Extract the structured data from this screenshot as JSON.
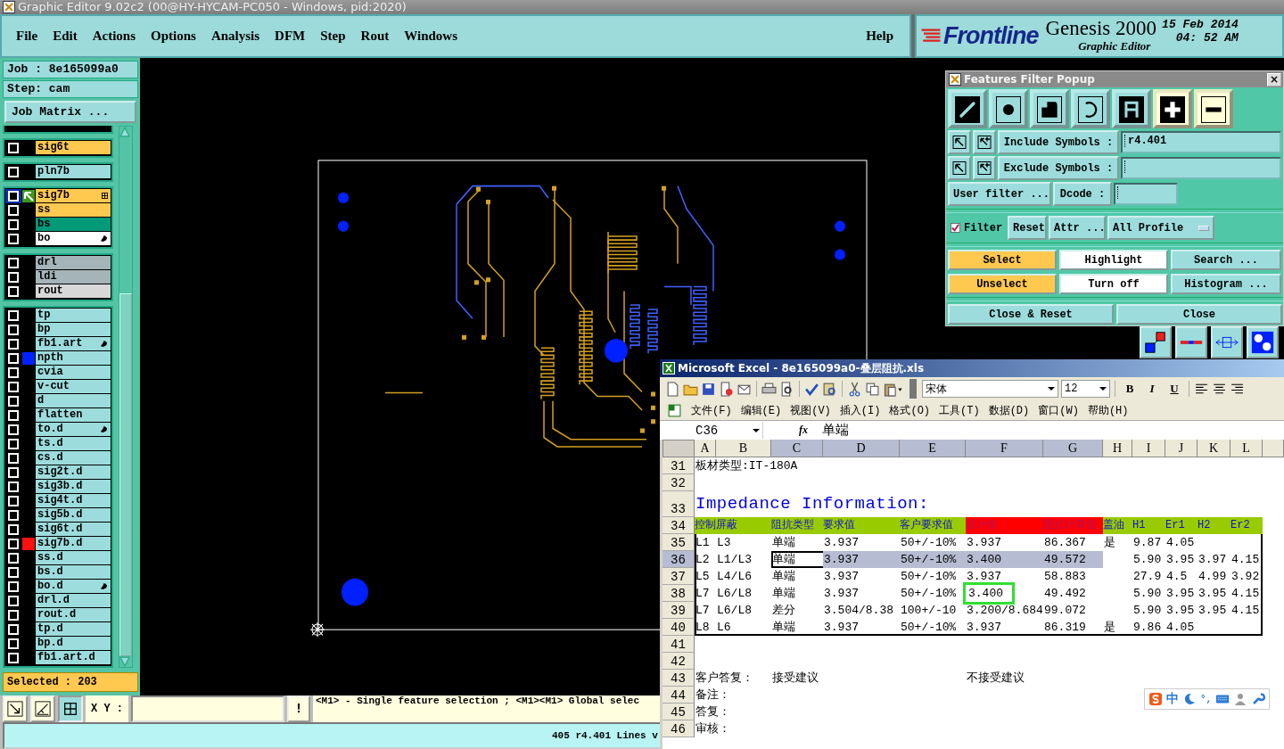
{
  "title_bar": {
    "title": "Graphic Editor 9.02c2 (00@HY-HYCAM-PC050 - Windows, pid:2020)"
  },
  "menu": [
    "File",
    "Edit",
    "Actions",
    "Options",
    "Analysis",
    "DFM",
    "Step",
    "Rout",
    "Windows"
  ],
  "help": "Help",
  "logo": {
    "brand": "Frontline",
    "product": "Genesis 2000",
    "subtitle": "Graphic Editor",
    "date": "15 Feb 2014",
    "time": "04: 52 AM"
  },
  "job": {
    "job": "Job : 8e165099a0",
    "step": "Step: cam",
    "matrix_button": "Job Matrix ...",
    "selected": "Selected : 203"
  },
  "layer_groups": [
    [
      {
        "name": "sig6t",
        "color": "#ffc84f",
        "work": false,
        "hand": false
      }
    ],
    [
      {
        "name": "pln7b",
        "color": "#9ddcdc",
        "work": false,
        "hand": false
      }
    ],
    [
      {
        "name": "sig7b",
        "color": "#ffc84f",
        "work": true,
        "hand": false
      },
      {
        "name": "ss",
        "color": "#ffc84f",
        "work": false,
        "hand": false
      },
      {
        "name": "bs",
        "color": "#009a78",
        "work": false,
        "hand": false
      },
      {
        "name": "bo",
        "color": "#ffffff",
        "work": false,
        "hand": true
      }
    ],
    [
      {
        "name": "drl",
        "color": "#a4b4b8",
        "work": false,
        "hand": false
      },
      {
        "name": "ldi",
        "color": "#a4b4b8",
        "work": false,
        "hand": false
      },
      {
        "name": "rout",
        "color": "#d8d8d8",
        "work": false,
        "hand": false
      }
    ],
    [
      {
        "name": "tp",
        "color": "#9ddcdc",
        "work": false,
        "hand": false
      },
      {
        "name": "bp",
        "color": "#9ddcdc",
        "work": false,
        "hand": false
      },
      {
        "name": "fb1.art",
        "color": "#9ddcdc",
        "work": false,
        "hand": true
      },
      {
        "name": "npth",
        "color": "#9ddcdc",
        "work": false,
        "hand": false,
        "display": {
          "color": "#0022ff"
        }
      },
      {
        "name": "cvia",
        "color": "#9ddcdc",
        "work": false,
        "hand": false
      },
      {
        "name": "v-cut",
        "color": "#9ddcdc",
        "work": false,
        "hand": false
      },
      {
        "name": "d",
        "color": "#9ddcdc",
        "work": false,
        "hand": false
      },
      {
        "name": "flatten",
        "color": "#9ddcdc",
        "work": false,
        "hand": false
      },
      {
        "name": "to.d",
        "color": "#9ddcdc",
        "work": false,
        "hand": true
      },
      {
        "name": "ts.d",
        "color": "#9ddcdc",
        "work": false,
        "hand": false
      },
      {
        "name": "cs.d",
        "color": "#9ddcdc",
        "work": false,
        "hand": false
      },
      {
        "name": "sig2t.d",
        "color": "#9ddcdc",
        "work": false,
        "hand": false
      },
      {
        "name": "sig3b.d",
        "color": "#9ddcdc",
        "work": false,
        "hand": false
      },
      {
        "name": "sig4t.d",
        "color": "#9ddcdc",
        "work": false,
        "hand": false
      },
      {
        "name": "sig5b.d",
        "color": "#9ddcdc",
        "work": false,
        "hand": false
      },
      {
        "name": "sig6t.d",
        "color": "#9ddcdc",
        "work": false,
        "hand": false
      },
      {
        "name": "sig7b.d",
        "color": "#9ddcdc",
        "work": false,
        "hand": false,
        "display": {
          "color": "#ff1010"
        }
      },
      {
        "name": "ss.d",
        "color": "#9ddcdc",
        "work": false,
        "hand": false
      },
      {
        "name": "bs.d",
        "color": "#9ddcdc",
        "work": false,
        "hand": false
      },
      {
        "name": "bo.d",
        "color": "#9ddcdc",
        "work": false,
        "hand": true
      },
      {
        "name": "drl.d",
        "color": "#9ddcdc",
        "work": false,
        "hand": false
      },
      {
        "name": "rout.d",
        "color": "#9ddcdc",
        "work": false,
        "hand": false
      },
      {
        "name": "tp.d",
        "color": "#9ddcdc",
        "work": false,
        "hand": false
      },
      {
        "name": "bp.d",
        "color": "#9ddcdc",
        "work": false,
        "hand": false
      },
      {
        "name": "fb1.art.d",
        "color": "#9ddcdc",
        "work": false,
        "hand": false
      }
    ]
  ],
  "filter_popup": {
    "title": "Features Filter Popup",
    "close": "×",
    "feature_types": [
      {
        "kind": "line",
        "selected": true
      },
      {
        "kind": "pad",
        "selected": false
      },
      {
        "kind": "surface",
        "selected": false
      },
      {
        "kind": "arc",
        "selected": false
      },
      {
        "kind": "text",
        "selected": true
      }
    ],
    "polarity": [
      {
        "kind": "positive",
        "selected": true
      },
      {
        "kind": "negative",
        "selected": false
      }
    ],
    "include": {
      "label": "Include Symbols :",
      "value": "r4.401"
    },
    "exclude": {
      "label": "Exclude Symbols :"
    },
    "user_filter": "User filter ...",
    "dcode": "Dcode :",
    "filter": {
      "label": "Filter",
      "checked": true
    },
    "reset": "Reset",
    "attr": "Attr ...",
    "profile": "All Profile",
    "actions": [
      {
        "label": "Select",
        "kind": "action"
      },
      {
        "label": "Highlight",
        "kind": "toggle"
      },
      {
        "label": "Search ...",
        "kind": "plain"
      },
      {
        "label": "Unselect",
        "kind": "action"
      },
      {
        "label": "Turn off",
        "kind": "toggle"
      },
      {
        "label": "Histogram ...",
        "kind": "plain"
      }
    ],
    "close_buttons": [
      "Close & Reset",
      "Close"
    ]
  },
  "toolbar": {
    "xy_label": "X Y :",
    "alert": "!",
    "message": "<M1> - Single feature selection ; <M1><M1> Global selec"
  },
  "status": "405 r4.401 Lines v",
  "excel": {
    "title": "Microsoft Excel - 8e165099a0-叠层阻抗.xls",
    "font": "宋体",
    "size": "12",
    "format_buttons": [
      "B",
      "I",
      "U"
    ],
    "menu": [
      "文件(F)",
      "编辑(E)",
      "视图(V)",
      "插入(I)",
      "格式(O)",
      "工具(T)",
      "数据(D)",
      "窗口(W)",
      "帮助(H)"
    ],
    "name_box": "C36",
    "fx": "fx",
    "formula": "单端",
    "columns": [
      {
        "letter": "A",
        "selected": false
      },
      {
        "letter": "B",
        "selected": false
      },
      {
        "letter": "C",
        "selected": true
      },
      {
        "letter": "D",
        "selected": true
      },
      {
        "letter": "E",
        "selected": true
      },
      {
        "letter": "F",
        "selected": true
      },
      {
        "letter": "G",
        "selected": true
      },
      {
        "letter": "H",
        "selected": false
      },
      {
        "letter": "I",
        "selected": false
      },
      {
        "letter": "J",
        "selected": false
      },
      {
        "letter": "K",
        "selected": false
      },
      {
        "letter": "L",
        "selected": false
      }
    ],
    "rows": [
      {
        "number": "31",
        "selected": false,
        "boxed": false,
        "cells": [
          {
            "text": "板材类型:IT-180A"
          }
        ]
      },
      {
        "number": "32",
        "selected": false,
        "boxed": false,
        "cells": []
      },
      {
        "number": "33",
        "selected": false,
        "boxed": false,
        "cells": [
          {
            "text": "Impedance Information:",
            "kind": "heading"
          }
        ]
      },
      {
        "number": "34",
        "selected": false,
        "boxed": true,
        "cells": [
          {
            "text": "控制",
            "color": "#99cc00"
          },
          {
            "text": "屏蔽",
            "color": "#99cc00"
          },
          {
            "text": "阻抗类型",
            "color": "#99cc00"
          },
          {
            "text": "要求值",
            "color": "#99cc00"
          },
          {
            "text": "客户要求值",
            "color": "#99cc00"
          },
          {
            "text": "设计值",
            "color": "#ff0000"
          },
          {
            "text": "阻抗计算值",
            "color": "#ff0000"
          },
          {
            "text": "盖油",
            "color": "#99cc00"
          },
          {
            "text": "H1",
            "color": "#99cc00"
          },
          {
            "text": "Er1",
            "color": "#99cc00"
          },
          {
            "text": "H2",
            "color": "#99cc00"
          },
          {
            "text": "Er2",
            "color": "#99cc00"
          }
        ]
      },
      {
        "number": "35",
        "selected": false,
        "boxed": true,
        "cells": [
          {
            "text": "L1"
          },
          {
            "text": "L3"
          },
          {
            "text": "单端"
          },
          {
            "text": "3.937"
          },
          {
            "text": "50+/-10%"
          },
          {
            "text": "3.937"
          },
          {
            "text": "86.367"
          },
          {
            "text": "是"
          },
          {
            "text": "9.87"
          },
          {
            "text": "4.05"
          }
        ]
      },
      {
        "number": "36",
        "selected": true,
        "boxed": true,
        "cells": [
          {
            "text": "L2"
          },
          {
            "text": "L1/L3"
          },
          {
            "text": "单端",
            "selected": true,
            "active": true
          },
          {
            "text": "3.937",
            "selected": true
          },
          {
            "text": "50+/-10%",
            "selected": true
          },
          {
            "text": "3.400",
            "selected": true
          },
          {
            "text": "49.572",
            "selected": true
          },
          {
            "text": ""
          },
          {
            "text": "5.90"
          },
          {
            "text": "3.95"
          },
          {
            "text": "3.97"
          },
          {
            "text": "4.15"
          }
        ]
      },
      {
        "number": "37",
        "selected": false,
        "boxed": true,
        "cells": [
          {
            "text": "L5"
          },
          {
            "text": "L4/L6"
          },
          {
            "text": "单端"
          },
          {
            "text": "3.937"
          },
          {
            "text": "50+/-10%"
          },
          {
            "text": "3.937"
          },
          {
            "text": "58.883"
          },
          {
            "text": ""
          },
          {
            "text": "27.9"
          },
          {
            "text": "4.5"
          },
          {
            "text": "4.99"
          },
          {
            "text": "3.92"
          }
        ]
      },
      {
        "number": "38",
        "selected": false,
        "boxed": true,
        "cells": [
          {
            "text": "L7"
          },
          {
            "text": "L6/L8"
          },
          {
            "text": "单端"
          },
          {
            "text": "3.937"
          },
          {
            "text": "50+/-10%"
          },
          {
            "text": "3.400",
            "outlined": true
          },
          {
            "text": "49.492"
          },
          {
            "text": ""
          },
          {
            "text": "5.90"
          },
          {
            "text": "3.95"
          },
          {
            "text": "3.95"
          },
          {
            "text": "4.15"
          }
        ]
      },
      {
        "number": "39",
        "selected": false,
        "boxed": true,
        "cells": [
          {
            "text": "L7"
          },
          {
            "text": "L6/L8"
          },
          {
            "text": "差分"
          },
          {
            "text": "3.504/8.38"
          },
          {
            "text": "100+/-10"
          },
          {
            "text": "3.200/8.684"
          },
          {
            "text": "99.072"
          },
          {
            "text": ""
          },
          {
            "text": "5.90"
          },
          {
            "text": "3.95"
          },
          {
            "text": "3.95"
          },
          {
            "text": "4.15"
          }
        ]
      },
      {
        "number": "40",
        "selected": false,
        "boxed": true,
        "cells": [
          {
            "text": "L8"
          },
          {
            "text": "L6"
          },
          {
            "text": "单端"
          },
          {
            "text": "3.937"
          },
          {
            "text": "50+/-10%"
          },
          {
            "text": "3.937"
          },
          {
            "text": "86.319"
          },
          {
            "text": "是"
          },
          {
            "text": "9.86"
          },
          {
            "text": "4.05"
          }
        ]
      },
      {
        "number": "41",
        "selected": false,
        "boxed": false,
        "cells": []
      },
      {
        "number": "42",
        "selected": false,
        "boxed": false,
        "cells": []
      },
      {
        "number": "43",
        "selected": false,
        "boxed": false,
        "cells": [
          {
            "text": "客户答复："
          },
          {
            "text": ""
          },
          {
            "text": "接受建议"
          },
          {
            "text": ""
          },
          {
            "text": ""
          },
          {
            "text": "不接受建议"
          }
        ]
      },
      {
        "number": "44",
        "selected": false,
        "boxed": false,
        "cells": [
          {
            "text": "备注："
          }
        ]
      },
      {
        "number": "45",
        "selected": false,
        "boxed": false,
        "cells": [
          {
            "text": "答复："
          }
        ]
      },
      {
        "number": "46",
        "selected": false,
        "boxed": false,
        "cells": [
          {
            "text": "审核："
          }
        ]
      }
    ],
    "ime": {
      "mode": "中",
      "punct": "°,"
    }
  }
}
